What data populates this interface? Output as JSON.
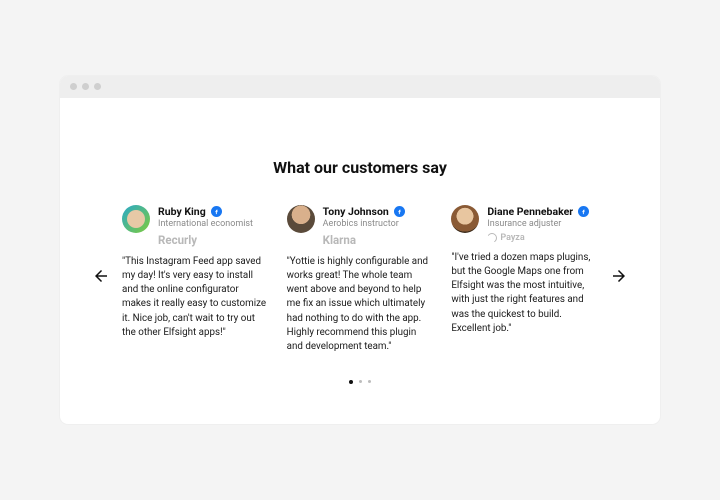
{
  "heading": "What our customers say",
  "nav": {
    "prev": "previous",
    "next": "next"
  },
  "testimonials": [
    {
      "name": "Ruby King",
      "role": "International economist",
      "company": "Recurly",
      "quote": "\"This Instagram Feed app saved my day! It's very easy to install and the online configurator makes it really easy to customize it. Nice job, can't wait to try out the other Elfsight apps!\""
    },
    {
      "name": "Tony Johnson",
      "role": "Aerobics instructor",
      "company": "Klarna",
      "quote": "\"Yottie is highly configurable and works great! The whole team went above and beyond to help me fix an issue which ultimately had nothing to do with the app. Highly recommend this plugin and development team.\""
    },
    {
      "name": "Diane Pennebaker",
      "role": "Insurance adjuster",
      "company": "Payza",
      "quote": "\"I've tried a dozen maps plugins, but the Google Maps one from Elfsight was the most intuitive, with just the right features and was the quickest to build. Excellent job.\""
    }
  ],
  "pagination": {
    "total": 3,
    "active": 0
  }
}
